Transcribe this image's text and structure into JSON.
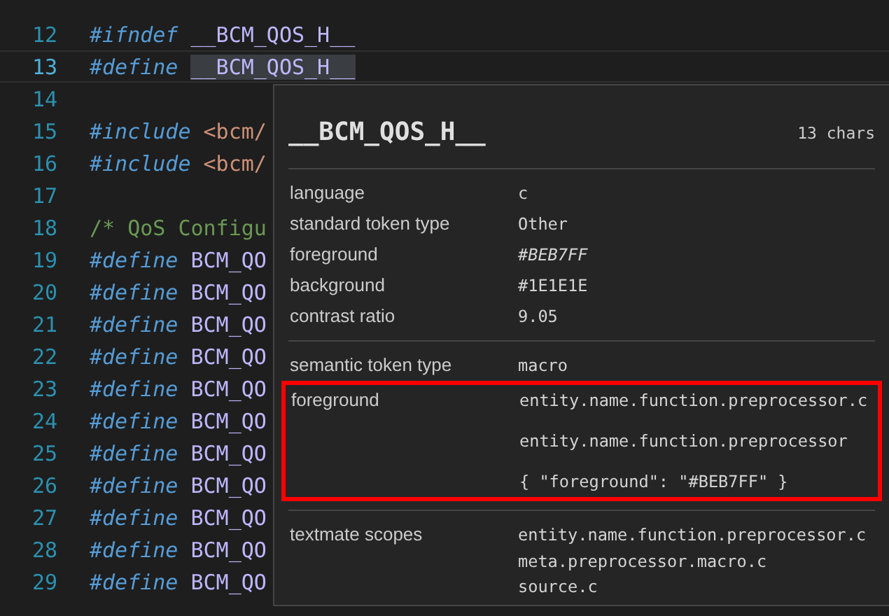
{
  "editor": {
    "lines": [
      {
        "number": "12",
        "current": false,
        "tokens": [
          {
            "kind": "keyword",
            "text": "#ifndef"
          },
          {
            "kind": "macro",
            "text": "__BCM_QOS_H__",
            "selected": false
          }
        ]
      },
      {
        "number": "13",
        "current": true,
        "tokens": [
          {
            "kind": "keyword",
            "text": "#define"
          },
          {
            "kind": "macro",
            "text": "__BCM_QOS_H__",
            "selected": true
          }
        ]
      },
      {
        "number": "14",
        "current": false
      },
      {
        "number": "15",
        "current": false,
        "tokens": [
          {
            "kind": "keyword",
            "text": "#include"
          },
          {
            "kind": "path",
            "text": "<bcm/"
          }
        ]
      },
      {
        "number": "16",
        "current": false,
        "tokens": [
          {
            "kind": "keyword",
            "text": "#include"
          },
          {
            "kind": "path",
            "text": "<bcm/"
          }
        ]
      },
      {
        "number": "17",
        "current": false
      },
      {
        "number": "18",
        "current": false,
        "tokens": [
          {
            "kind": "comment",
            "text": "/* QoS Configu"
          }
        ]
      },
      {
        "number": "19",
        "current": false,
        "tokens": [
          {
            "kind": "keyword",
            "text": "#define"
          },
          {
            "kind": "macro",
            "text": "BCM_QO",
            "selected": false
          }
        ]
      },
      {
        "number": "20",
        "current": false,
        "tokens": [
          {
            "kind": "keyword",
            "text": "#define"
          },
          {
            "kind": "macro",
            "text": "BCM_QO",
            "selected": false
          }
        ]
      },
      {
        "number": "21",
        "current": false,
        "tokens": [
          {
            "kind": "keyword",
            "text": "#define"
          },
          {
            "kind": "macro",
            "text": "BCM_QO",
            "selected": false
          }
        ]
      },
      {
        "number": "22",
        "current": false,
        "tokens": [
          {
            "kind": "keyword",
            "text": "#define"
          },
          {
            "kind": "macro",
            "text": "BCM_QO",
            "selected": false
          }
        ]
      },
      {
        "number": "23",
        "current": false,
        "tokens": [
          {
            "kind": "keyword",
            "text": "#define"
          },
          {
            "kind": "macro",
            "text": "BCM_QO",
            "selected": false
          }
        ]
      },
      {
        "number": "24",
        "current": false,
        "tokens": [
          {
            "kind": "keyword",
            "text": "#define"
          },
          {
            "kind": "macro",
            "text": "BCM_QO",
            "selected": false
          }
        ]
      },
      {
        "number": "25",
        "current": false,
        "tokens": [
          {
            "kind": "keyword",
            "text": "#define"
          },
          {
            "kind": "macro",
            "text": "BCM_QO",
            "selected": false
          }
        ]
      },
      {
        "number": "26",
        "current": false,
        "tokens": [
          {
            "kind": "keyword",
            "text": "#define"
          },
          {
            "kind": "macro",
            "text": "BCM_QO",
            "selected": false
          }
        ]
      },
      {
        "number": "27",
        "current": false,
        "tokens": [
          {
            "kind": "keyword",
            "text": "#define"
          },
          {
            "kind": "macro",
            "text": "BCM_QO",
            "selected": false
          }
        ]
      },
      {
        "number": "28",
        "current": false,
        "tokens": [
          {
            "kind": "keyword",
            "text": "#define"
          },
          {
            "kind": "macro",
            "text": "BCM_QO",
            "selected": false
          }
        ]
      },
      {
        "number": "29",
        "current": false,
        "tokens": [
          {
            "kind": "keyword",
            "text": "#define"
          },
          {
            "kind": "macro",
            "text": "BCM_QO",
            "selected": false
          }
        ]
      }
    ]
  },
  "inspector": {
    "title": "__BCM_QOS_H__",
    "length": "13 chars",
    "sections": [
      {
        "rows": [
          {
            "label": "language",
            "highlighted": false,
            "values": [
              {
                "text": "c",
                "italic": false
              }
            ]
          },
          {
            "label": "standard token type",
            "highlighted": false,
            "values": [
              {
                "text": "Other",
                "italic": false
              }
            ]
          },
          {
            "label": "foreground",
            "highlighted": false,
            "values": [
              {
                "text": "#BEB7FF",
                "italic": true
              }
            ]
          },
          {
            "label": "background",
            "highlighted": false,
            "values": [
              {
                "text": "#1E1E1E",
                "italic": false
              }
            ]
          },
          {
            "label": "contrast ratio",
            "highlighted": false,
            "values": [
              {
                "text": "9.05",
                "italic": false
              }
            ]
          }
        ]
      },
      {
        "rows": [
          {
            "label": "semantic token type",
            "highlighted": false,
            "values": [
              {
                "text": "macro",
                "italic": false
              }
            ]
          },
          {
            "label": "foreground",
            "highlighted": true,
            "values": [
              {
                "text": "entity.name.function.preprocessor.c",
                "italic": false
              },
              {
                "text": "entity.name.function.preprocessor",
                "italic": false
              },
              {
                "text": "{ \"foreground\": \"#BEB7FF\" }",
                "italic": false
              }
            ]
          }
        ]
      },
      {
        "rows": [
          {
            "label": "textmate scopes",
            "highlighted": false,
            "compact": true,
            "values": [
              {
                "text": "entity.name.function.preprocessor.c",
                "italic": false
              },
              {
                "text": "meta.preprocessor.macro.c",
                "italic": false
              },
              {
                "text": "source.c",
                "italic": false
              }
            ]
          }
        ]
      }
    ]
  }
}
